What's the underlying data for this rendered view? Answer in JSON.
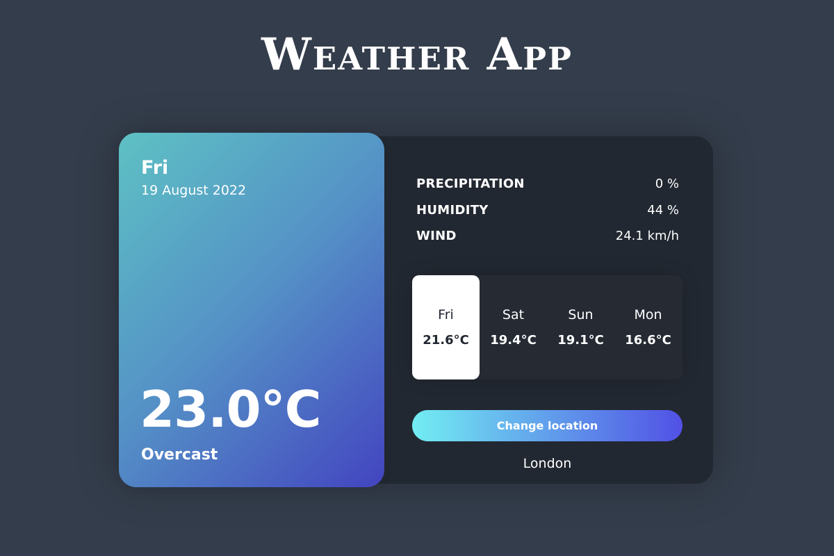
{
  "app": {
    "title": "Weather App"
  },
  "today": {
    "day": "Fri",
    "date": "19 August 2022",
    "temperature": "23.0°C",
    "condition": "Overcast"
  },
  "stats": [
    {
      "label": "PRECIPITATION",
      "value": "0 %"
    },
    {
      "label": "HUMIDITY",
      "value": "44 %"
    },
    {
      "label": "WIND",
      "value": "24.1 km/h"
    }
  ],
  "forecast": [
    {
      "day": "Fri",
      "temp": "21.6°C",
      "active": true
    },
    {
      "day": "Sat",
      "temp": "19.4°C",
      "active": false
    },
    {
      "day": "Sun",
      "temp": "19.1°C",
      "active": false
    },
    {
      "day": "Mon",
      "temp": "16.6°C",
      "active": false
    }
  ],
  "location": {
    "button_label": "Change location",
    "name": "London"
  },
  "colors": {
    "background": "#343d4b",
    "panel": "#222831",
    "gradient_start": "#5ec1c4",
    "gradient_end": "#4344c0",
    "button_gradient_start": "#72edf2",
    "button_gradient_end": "#5151e5"
  }
}
